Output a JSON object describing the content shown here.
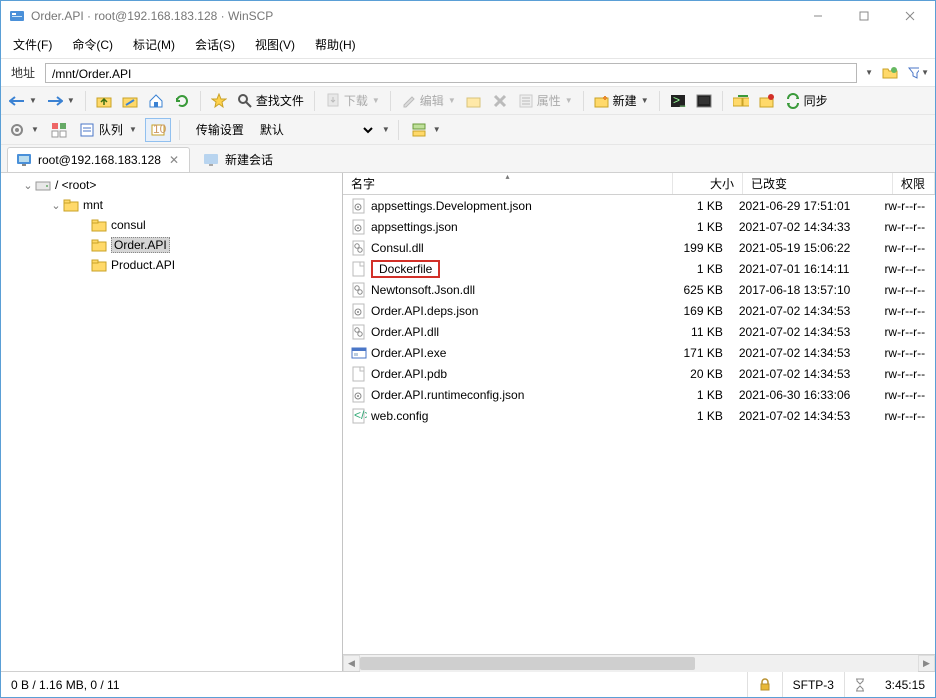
{
  "window": {
    "title": "Order.API · root@192.168.183.128 · WinSCP"
  },
  "menu": [
    "文件(F)",
    "命令(C)",
    "标记(M)",
    "会话(S)",
    "视图(V)",
    "帮助(H)"
  ],
  "addr": {
    "label": "地址",
    "path": "/mnt/Order.API"
  },
  "tb1": {
    "find": "查找文件",
    "download": "下载",
    "edit": "编辑",
    "props": "属性",
    "new": "新建",
    "sync": "同步"
  },
  "tb2": {
    "queue": "队列",
    "transfer_label": "传输设置",
    "transfer_value": "默认"
  },
  "tabs": {
    "session": "root@192.168.183.128",
    "new": "新建会话"
  },
  "tree": {
    "root": "/ <root>",
    "mnt": "mnt",
    "children": [
      "consul",
      "Order.API",
      "Product.API"
    ],
    "selected": "Order.API"
  },
  "cols": {
    "name": "名字",
    "size": "大小",
    "date": "已改变",
    "perm": "权限"
  },
  "files": [
    {
      "icon": "gear",
      "name": "appsettings.Development.json",
      "size": "1 KB",
      "date": "2021-06-29 17:51:01",
      "perm": "rw-r--r--",
      "hl": false
    },
    {
      "icon": "gear",
      "name": "appsettings.json",
      "size": "1 KB",
      "date": "2021-07-02 14:34:33",
      "perm": "rw-r--r--",
      "hl": false
    },
    {
      "icon": "dll",
      "name": "Consul.dll",
      "size": "199 KB",
      "date": "2021-05-19 15:06:22",
      "perm": "rw-r--r--",
      "hl": false
    },
    {
      "icon": "file",
      "name": "Dockerfile",
      "size": "1 KB",
      "date": "2021-07-01 16:14:11",
      "perm": "rw-r--r--",
      "hl": true
    },
    {
      "icon": "dll",
      "name": "Newtonsoft.Json.dll",
      "size": "625 KB",
      "date": "2017-06-18 13:57:10",
      "perm": "rw-r--r--",
      "hl": false
    },
    {
      "icon": "gear",
      "name": "Order.API.deps.json",
      "size": "169 KB",
      "date": "2021-07-02 14:34:53",
      "perm": "rw-r--r--",
      "hl": false
    },
    {
      "icon": "dll",
      "name": "Order.API.dll",
      "size": "11 KB",
      "date": "2021-07-02 14:34:53",
      "perm": "rw-r--r--",
      "hl": false
    },
    {
      "icon": "exe",
      "name": "Order.API.exe",
      "size": "171 KB",
      "date": "2021-07-02 14:34:53",
      "perm": "rw-r--r--",
      "hl": false
    },
    {
      "icon": "file",
      "name": "Order.API.pdb",
      "size": "20 KB",
      "date": "2021-07-02 14:34:53",
      "perm": "rw-r--r--",
      "hl": false
    },
    {
      "icon": "gear",
      "name": "Order.API.runtimeconfig.json",
      "size": "1 KB",
      "date": "2021-06-30 16:33:06",
      "perm": "rw-r--r--",
      "hl": false
    },
    {
      "icon": "code",
      "name": "web.config",
      "size": "1 KB",
      "date": "2021-07-02 14:34:53",
      "perm": "rw-r--r--",
      "hl": false
    }
  ],
  "status": {
    "left": "0 B / 1.16 MB,   0 / 11",
    "proto": "SFTP-3",
    "time": "3:45:15"
  }
}
